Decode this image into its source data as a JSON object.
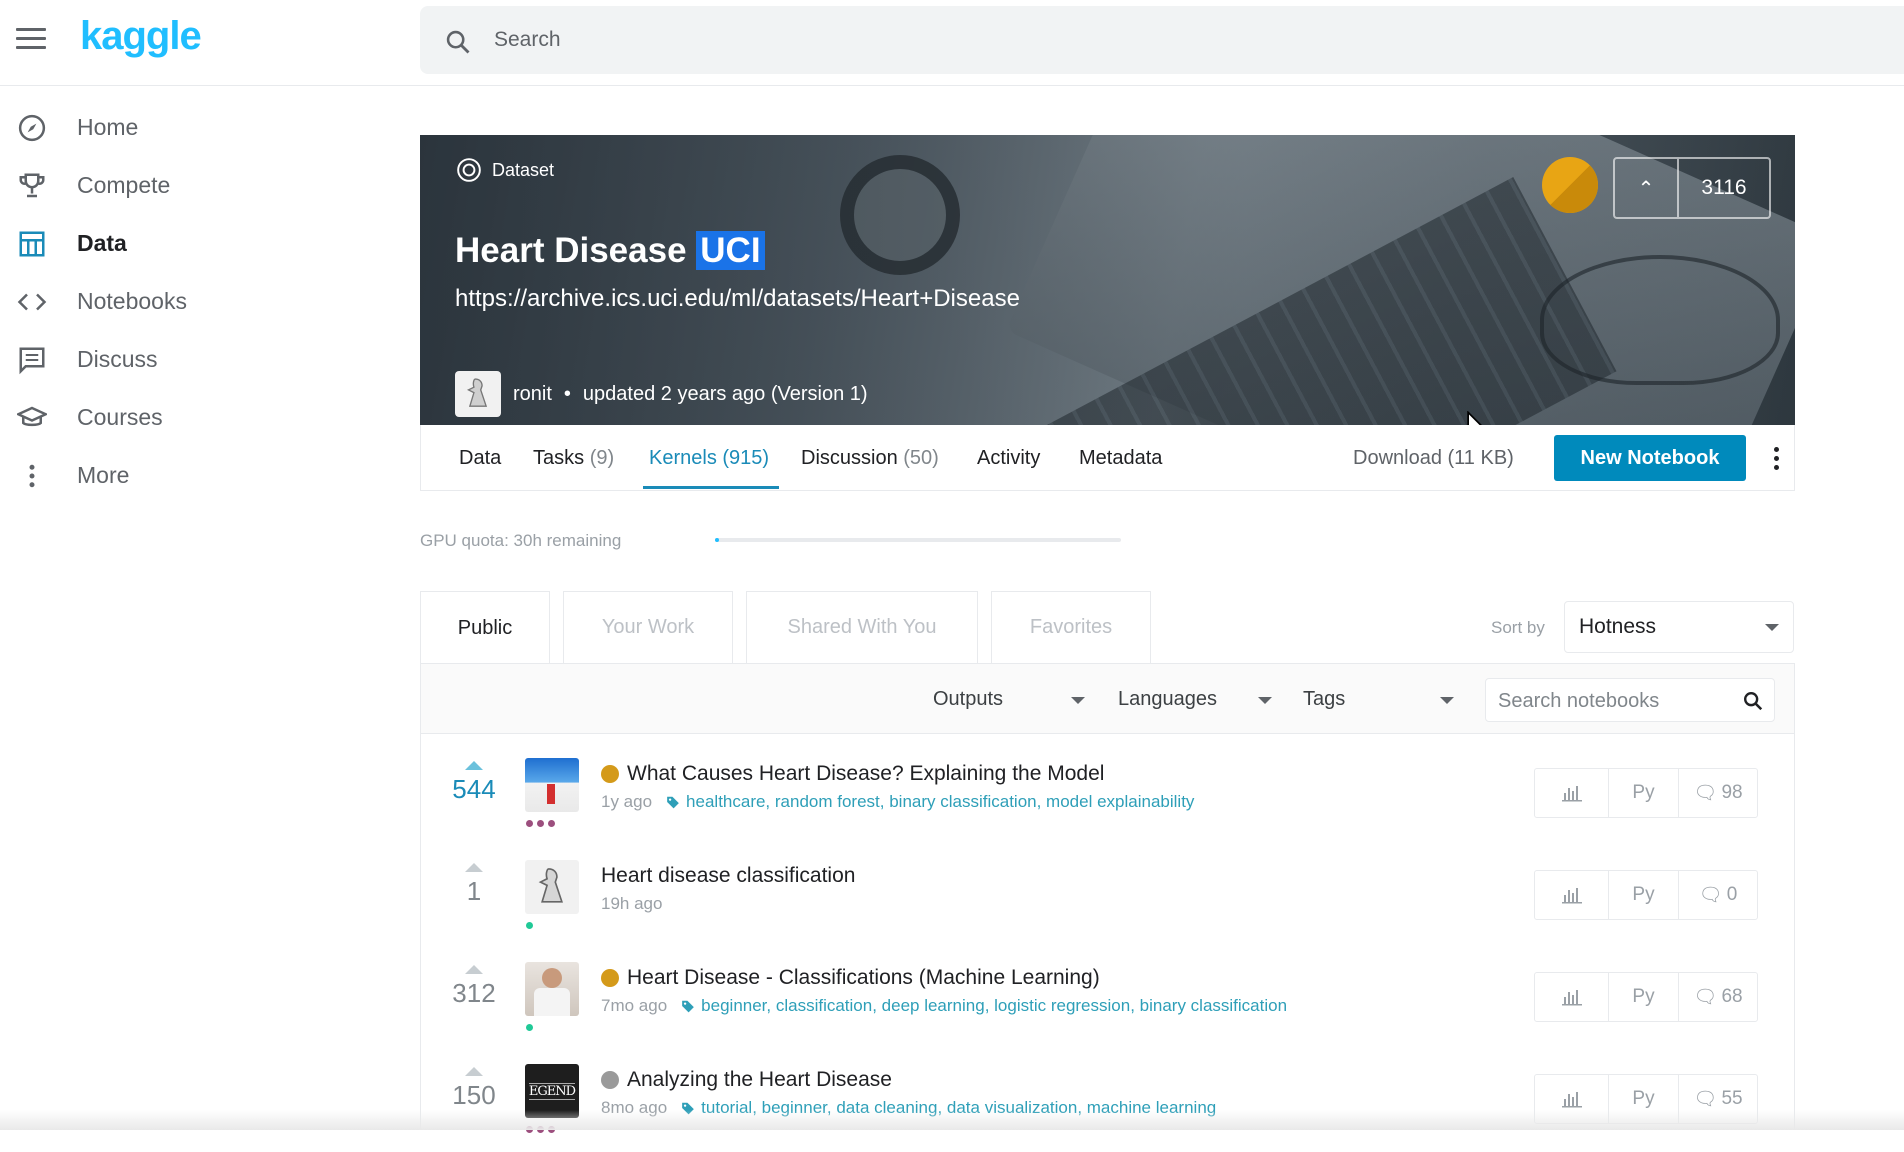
{
  "app": {
    "logo_text": "kaggle",
    "search_placeholder": "Search"
  },
  "sidebar": {
    "items": [
      {
        "label": "Home",
        "icon": "compass-icon",
        "active": false
      },
      {
        "label": "Compete",
        "icon": "trophy-icon",
        "active": false
      },
      {
        "label": "Data",
        "icon": "table-icon",
        "active": true
      },
      {
        "label": "Notebooks",
        "icon": "code-icon",
        "active": false
      },
      {
        "label": "Discuss",
        "icon": "comment-icon",
        "active": false
      },
      {
        "label": "Courses",
        "icon": "graduation-cap-icon",
        "active": false
      },
      {
        "label": "More",
        "icon": "more-vertical-icon",
        "active": false
      }
    ]
  },
  "dataset": {
    "type_label": "Dataset",
    "title_main": "Heart Disease",
    "title_highlight": "UCI",
    "subtitle": "https://archive.ics.uci.edu/ml/datasets/Heart+Disease",
    "author": "ronit",
    "updated": "updated 2 years ago (Version 1)",
    "upvotes": "3116",
    "medal_color": "#e8a514"
  },
  "dataset_tabs": [
    {
      "label": "Data",
      "count": ""
    },
    {
      "label": "Tasks",
      "count": "(9)"
    },
    {
      "label": "Kernels",
      "count": "(915)"
    },
    {
      "label": "Discussion",
      "count": "(50)"
    },
    {
      "label": "Activity",
      "count": ""
    },
    {
      "label": "Metadata",
      "count": ""
    }
  ],
  "actions": {
    "download": "Download (11 KB)",
    "new_notebook": "New Notebook"
  },
  "gpu": {
    "label": "GPU quota: 30h remaining",
    "used_fraction": 0.01
  },
  "kernel_tabs": [
    "Public",
    "Your Work",
    "Shared With You",
    "Favorites"
  ],
  "sort": {
    "label": "Sort by",
    "value": "Hotness"
  },
  "filters": {
    "outputs": "Outputs",
    "languages": "Languages",
    "tags": "Tags",
    "search_placeholder": "Search notebooks"
  },
  "kernels": [
    {
      "votes": "544",
      "hot": true,
      "title": "What Causes Heart Disease? Explaining the Model",
      "medal": "gold",
      "age": "1y ago",
      "tags": "healthcare, random forest, binary classification, model explainability",
      "lang": "Py",
      "comments": "98"
    },
    {
      "votes": "1",
      "hot": false,
      "title": "Heart disease classification",
      "medal": "",
      "age": "19h ago",
      "tags": "",
      "lang": "Py",
      "comments": "0"
    },
    {
      "votes": "312",
      "hot": false,
      "title": "Heart Disease - Classifications (Machine Learning)",
      "medal": "gold",
      "age": "7mo ago",
      "tags": "beginner, classification, deep learning, logistic regression, binary classification",
      "lang": "Py",
      "comments": "68"
    },
    {
      "votes": "150",
      "hot": false,
      "title": "Analyzing the Heart Disease",
      "medal": "silver",
      "age": "8mo ago",
      "tags": "tutorial, beginner, data cleaning, data visualization, machine learning",
      "lang": "Py",
      "comments": "55"
    }
  ],
  "colors": {
    "accent": "#20beff",
    "primary_button": "#008abc",
    "tag_link": "#2e9fb8"
  }
}
